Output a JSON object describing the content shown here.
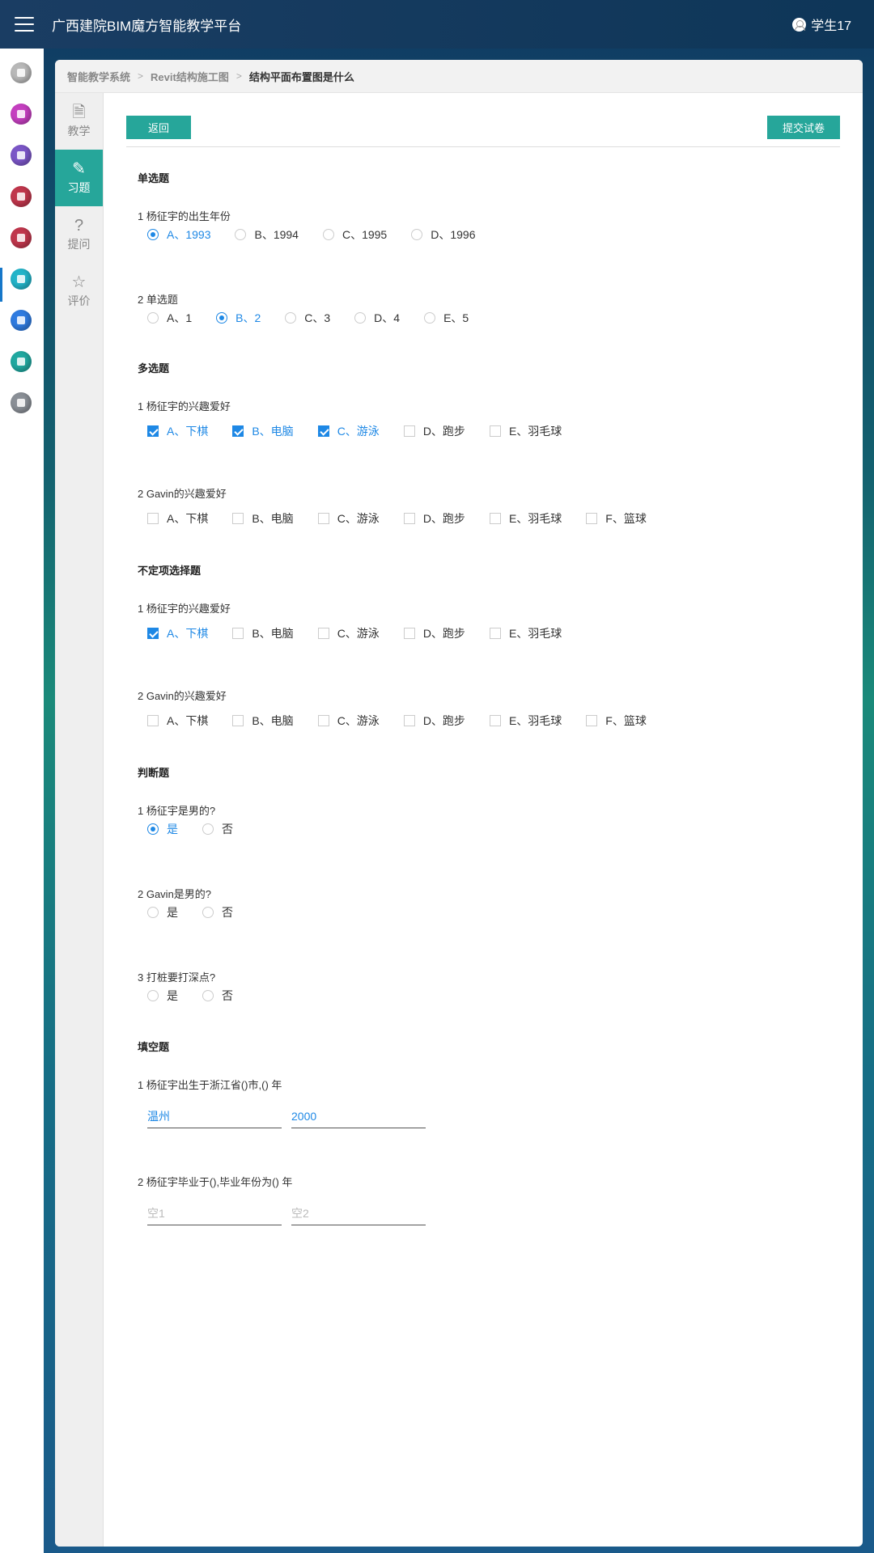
{
  "app": {
    "title": "广西建院BIM魔方智能教学平台",
    "user": "学生17"
  },
  "rail": {
    "items": [
      {
        "name": "home",
        "color": "#b8b8b8"
      },
      {
        "name": "bell",
        "color": "#c53fc0"
      },
      {
        "name": "user",
        "color": "#7b56c7"
      },
      {
        "name": "books",
        "color": "#c0364c"
      },
      {
        "name": "library",
        "color": "#c0364c"
      },
      {
        "name": "course",
        "color": "#23b4c9"
      },
      {
        "name": "qa",
        "color": "#2f7be0"
      },
      {
        "name": "eval",
        "color": "#20a8a0"
      },
      {
        "name": "settings",
        "color": "#8a8f96"
      }
    ]
  },
  "breadcrumb": [
    "智能教学系统",
    "Revit结构施工图",
    "结构平面布置图是什么"
  ],
  "subnav": [
    {
      "label": "教学",
      "icon": "🗎"
    },
    {
      "label": "习题",
      "icon": "✎"
    },
    {
      "label": "提问",
      "icon": "?"
    },
    {
      "label": "评价",
      "icon": "☆"
    }
  ],
  "toolbar": {
    "back": "返回",
    "submit": "提交试卷"
  },
  "sections": {
    "single": "单选题",
    "multi": "多选题",
    "indef": "不定项选择题",
    "judge": "判断题",
    "fill": "填空题"
  },
  "questions": {
    "s1": {
      "title": "1 杨征宇的出生年份",
      "options": [
        "A、1993",
        "B、1994",
        "C、1995",
        "D、1996"
      ],
      "selected": 0
    },
    "s2": {
      "title": "2 单选题",
      "options": [
        "A、1",
        "B、2",
        "C、3",
        "D、4",
        "E、5"
      ],
      "selected": 1
    },
    "m1": {
      "title": "1 杨征宇的兴趣爱好",
      "options": [
        "A、下棋",
        "B、电脑",
        "C、游泳",
        "D、跑步",
        "E、羽毛球"
      ],
      "checked": [
        0,
        1,
        2
      ]
    },
    "m2": {
      "title": "2 Gavin的兴趣爱好",
      "options": [
        "A、下棋",
        "B、电脑",
        "C、游泳",
        "D、跑步",
        "E、羽毛球",
        "F、篮球"
      ],
      "checked": []
    },
    "i1": {
      "title": "1 杨征宇的兴趣爱好",
      "options": [
        "A、下棋",
        "B、电脑",
        "C、游泳",
        "D、跑步",
        "E、羽毛球"
      ],
      "checked": [
        0
      ]
    },
    "i2": {
      "title": "2 Gavin的兴趣爱好",
      "options": [
        "A、下棋",
        "B、电脑",
        "C、游泳",
        "D、跑步",
        "E、羽毛球",
        "F、篮球"
      ],
      "checked": []
    },
    "j1": {
      "title": "1 杨征宇是男的?",
      "options": [
        "是",
        "否"
      ],
      "selected": 0
    },
    "j2": {
      "title": "2 Gavin是男的?",
      "options": [
        "是",
        "否"
      ],
      "selected": -1
    },
    "j3": {
      "title": "3 打桩要打深点?",
      "options": [
        "是",
        "否"
      ],
      "selected": -1
    },
    "f1": {
      "title": "1 杨征宇出生于浙江省()市,() 年",
      "values": [
        "温州",
        "2000"
      ],
      "placeholders": [
        "空1",
        "空2"
      ]
    },
    "f2": {
      "title": "2 杨征宇毕业于(),毕业年份为() 年",
      "values": [
        "",
        ""
      ],
      "placeholders": [
        "空1",
        "空2"
      ]
    }
  }
}
